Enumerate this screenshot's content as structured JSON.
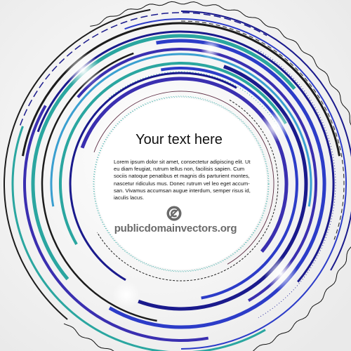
{
  "headline": "Your text here",
  "body_text": "Lorem ipsum dolor sit amet, consectetur adipiscing elit. Ut eu diam feugiat, rutrum tellus non, facilisis sapien. Cum sociis natoque penatibus et magnis dis parturient montes, nascetur ridiculus mus. Donec rutrum vel leo eget accumsan. Vivamus accumsan augue interdum, semper risus id, iaculis lacus.",
  "body_lines": [
    "Lorem ipsum dolor sit amet, consectetur adipiscing elit. Ut",
    "eu diam feugiat, rutrum tellus non, facilisis sapien. Cum",
    "sociis natoque penatibus et magnis dis parturient montes,",
    "nascetur ridiculus mus. Donec rutrum vel leo eget accum-",
    "san. Vivamus accumsan augue interdum, semper risus id,",
    "iaculis lacus."
  ],
  "logo_icon": "public-domain-icon",
  "site_url": "publicdomainvectors.org",
  "colors": {
    "navy": "#1a1a8c",
    "indigo": "#3a2fb0",
    "royal": "#2c3cc8",
    "teal": "#2aa6a0",
    "sky": "#3a9fd0",
    "black": "#1c1c1c",
    "gray_text": "#6a6a6a"
  }
}
